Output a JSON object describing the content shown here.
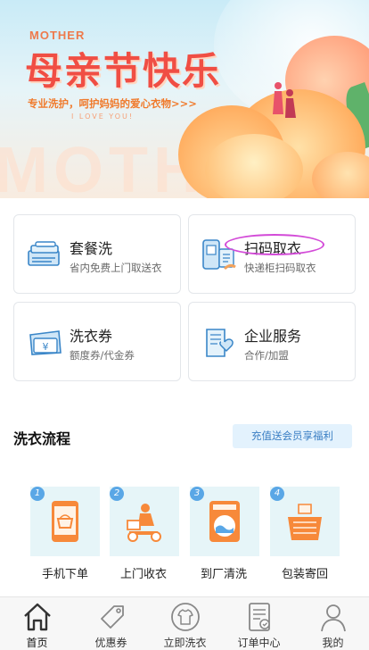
{
  "banner": {
    "mother_small": "MOTHER",
    "title": "母亲节快乐",
    "slogan": "专业洗护，呵护妈妈的爱心衣物>>>",
    "love": "I LOVE YOU!",
    "mother_big": "MOTHER"
  },
  "services": [
    {
      "title": "套餐洗",
      "subtitle": "省内免费上门取送衣",
      "icon": "package-wash-icon"
    },
    {
      "title": "扫码取衣",
      "subtitle": "快递柜扫码取衣",
      "icon": "scan-locker-icon"
    },
    {
      "title": "洗衣券",
      "subtitle": "额度券/代金券",
      "icon": "coupon-icon"
    },
    {
      "title": "企业服务",
      "subtitle": "合作/加盟",
      "icon": "enterprise-icon"
    }
  ],
  "process": {
    "title": "洗衣流程",
    "promo": "充值送会员享福利",
    "steps": [
      {
        "num": "1",
        "label": "手机下单",
        "icon": "phone-order-icon"
      },
      {
        "num": "2",
        "label": "上门收衣",
        "icon": "delivery-scooter-icon"
      },
      {
        "num": "3",
        "label": "到厂清洗",
        "icon": "washing-machine-icon"
      },
      {
        "num": "4",
        "label": "包装寄回",
        "icon": "basket-icon"
      }
    ]
  },
  "tabs": [
    {
      "label": "首页",
      "icon": "home-icon",
      "active": true
    },
    {
      "label": "优惠券",
      "icon": "tag-icon"
    },
    {
      "label": "立即洗衣",
      "icon": "shirt-icon"
    },
    {
      "label": "订单中心",
      "icon": "order-icon"
    },
    {
      "label": "我的",
      "icon": "user-icon"
    }
  ],
  "colors": {
    "accent_blue": "#5aa7e6",
    "banner_title": "#f04e44",
    "promo_text": "#3b7fc4",
    "highlight": "#d34bd8"
  }
}
